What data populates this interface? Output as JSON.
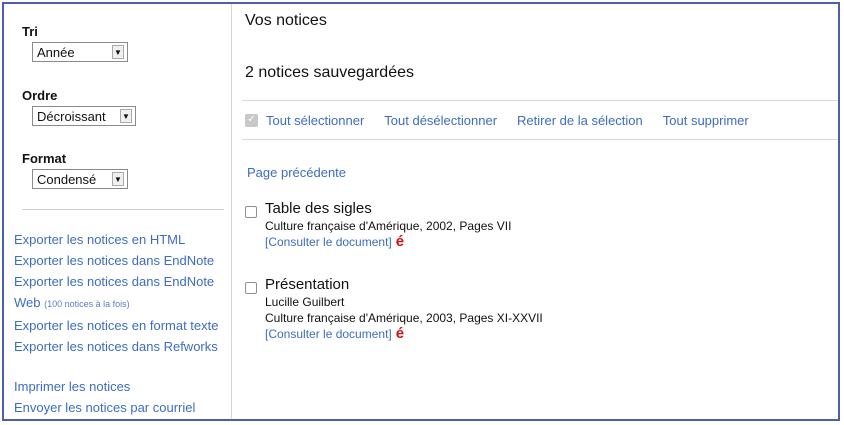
{
  "sidebar": {
    "sort": {
      "label": "Tri",
      "value": "Année"
    },
    "order": {
      "label": "Ordre",
      "value": "Décroissant"
    },
    "format": {
      "label": "Format",
      "value": "Condensé"
    },
    "exports": [
      "Exporter les notices en HTML",
      "Exporter les notices dans EndNote",
      "Exporter les notices dans EndNote",
      "Web",
      "Exporter les notices en format texte",
      "Exporter les notices dans Refworks"
    ],
    "export_web_note": "(100 notices à la fois)",
    "print": "Imprimer les notices",
    "email": "Envoyer les notices par courriel"
  },
  "main": {
    "title": "Vos notices",
    "count": "2 notices sauvegardées",
    "toolbar": {
      "select_all": "Tout sélectionner",
      "deselect_all": "Tout désélectionner",
      "remove_selection": "Retirer de la sélection",
      "delete_all": "Tout supprimer"
    },
    "prev_page": "Page précédente",
    "records": [
      {
        "title": "Table des sigles",
        "author": "",
        "source": "Culture française d'Amérique, 2002, Pages VII",
        "link": "[Consulter le document]"
      },
      {
        "title": "Présentation",
        "author": "Lucille Guilbert",
        "source": "Culture française d'Amérique, 2003, Pages XI-XXVII",
        "link": "[Consulter le document]"
      }
    ],
    "erudit_glyph": "é"
  },
  "colors": {
    "link": "#3d6cc1",
    "frame": "#4a5fae",
    "erudit": "#cc1111"
  }
}
